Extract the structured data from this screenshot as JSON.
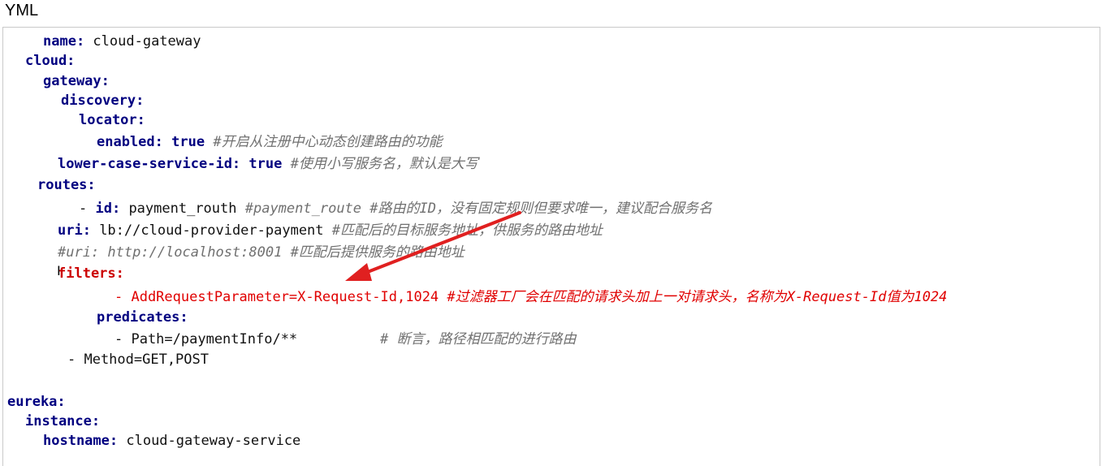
{
  "window": {
    "title": "YML"
  },
  "lines": {
    "l1": {
      "key": "name:",
      "value": " cloud-gateway"
    },
    "l2": {
      "key": "cloud:"
    },
    "l3": {
      "key": "gateway:"
    },
    "l4": {
      "key": "discovery:"
    },
    "l5": {
      "key": "locator:"
    },
    "l6": {
      "key": "enabled:",
      "value": "true",
      "comment": " #开启从注册中心动态创建路由的功能"
    },
    "l7": {
      "key": "lower-case-service-id:",
      "value": "true",
      "comment": " #使用小写服务名，默认是大写"
    },
    "l8": {
      "key": "routes:"
    },
    "l9": {
      "dash": "- ",
      "key": "id:",
      "value": " payment_routh",
      "comment": " #payment_route #路由的ID，没有固定规则但要求唯一，建议配合服务名"
    },
    "l10": {
      "key": "uri:",
      "value": " lb://cloud-provider-payment",
      "comment": " #匹配后的目标服务地址，供服务的路由地址"
    },
    "l11": {
      "comment": "#uri: http://localhost:8001 #匹配后提供服务的路由地址"
    },
    "l12": {
      "key": "filters:"
    },
    "l13": {
      "value": "- AddRequestParameter=X-Request-Id,1024",
      "comment": " #过滤器工厂会在匹配的请求头加上一对请求头，名称为X-Request-Id值为1024"
    },
    "l14": {
      "key": "predicates:"
    },
    "l15": {
      "value": "- Path=/paymentInfo/**",
      "comment": "# 断言，路径相匹配的进行路由"
    },
    "l16": {
      "value": "- Method=GET,POST"
    },
    "l17": {
      "key": "eureka:"
    },
    "l18": {
      "key": "instance:"
    },
    "l19": {
      "key": "hostname:",
      "value": " cloud-gateway-service"
    }
  },
  "annotation": {
    "arrow_color": "#e02020",
    "cursor_icon": "text-cursor-icon"
  }
}
